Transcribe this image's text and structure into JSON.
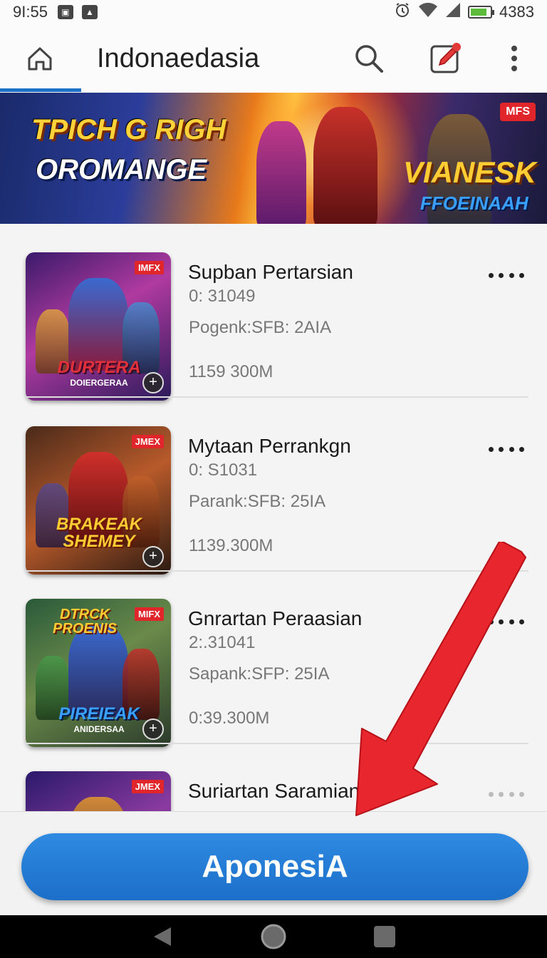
{
  "status_bar": {
    "time": "9I:55",
    "right_text": "4383",
    "battery_level": 0.85
  },
  "app_bar": {
    "title": "Indonaedasia",
    "icons": [
      "home-icon",
      "search-icon",
      "edit-note-icon",
      "more-vertical-icon"
    ]
  },
  "banner": {
    "line1": "TPICH G RIGH",
    "line2": "OROMANGE",
    "right_line1": "VIANESK",
    "right_line2": "FFOEINAAH",
    "tag": "MFS"
  },
  "items": [
    {
      "title": "Supban Pertarsian",
      "subtitle": "0: 31049",
      "rank": "Pogenk:SFB: 2AIA",
      "size": "1159 300M",
      "thumb_title": "DURTERA",
      "thumb_subtitle": "DOIERGERAA",
      "thumb_badge": "IMFX"
    },
    {
      "title": "Mytaan Perrankgn",
      "subtitle": "0: S1031",
      "rank": "Parank:SFB: 25IA",
      "size": "1139.300M",
      "thumb_title": "BRAKEAK SHEMEY",
      "thumb_subtitle": "",
      "thumb_badge": "JMEX"
    },
    {
      "title": "Gnrartan Peraasian",
      "subtitle": "2:.31041",
      "rank": "Sapank:SFP: 25IA",
      "size": "0:39.300M",
      "thumb_title": "PIREIEAK",
      "thumb_subtitle": "ANIDERSAA",
      "thumb_top": "DTRCK PROENIS",
      "thumb_badge": "MIFX"
    },
    {
      "title": "Suriartan Saramian",
      "subtitle": "",
      "rank": "",
      "size": "",
      "thumb_title": "",
      "thumb_subtitle": "",
      "thumb_badge": "JMEX"
    }
  ],
  "primary_button": {
    "label": "AponesiA"
  },
  "colors": {
    "accent": "#1e73c8",
    "arrow": "#e8262e",
    "badge": "#e0262a"
  }
}
